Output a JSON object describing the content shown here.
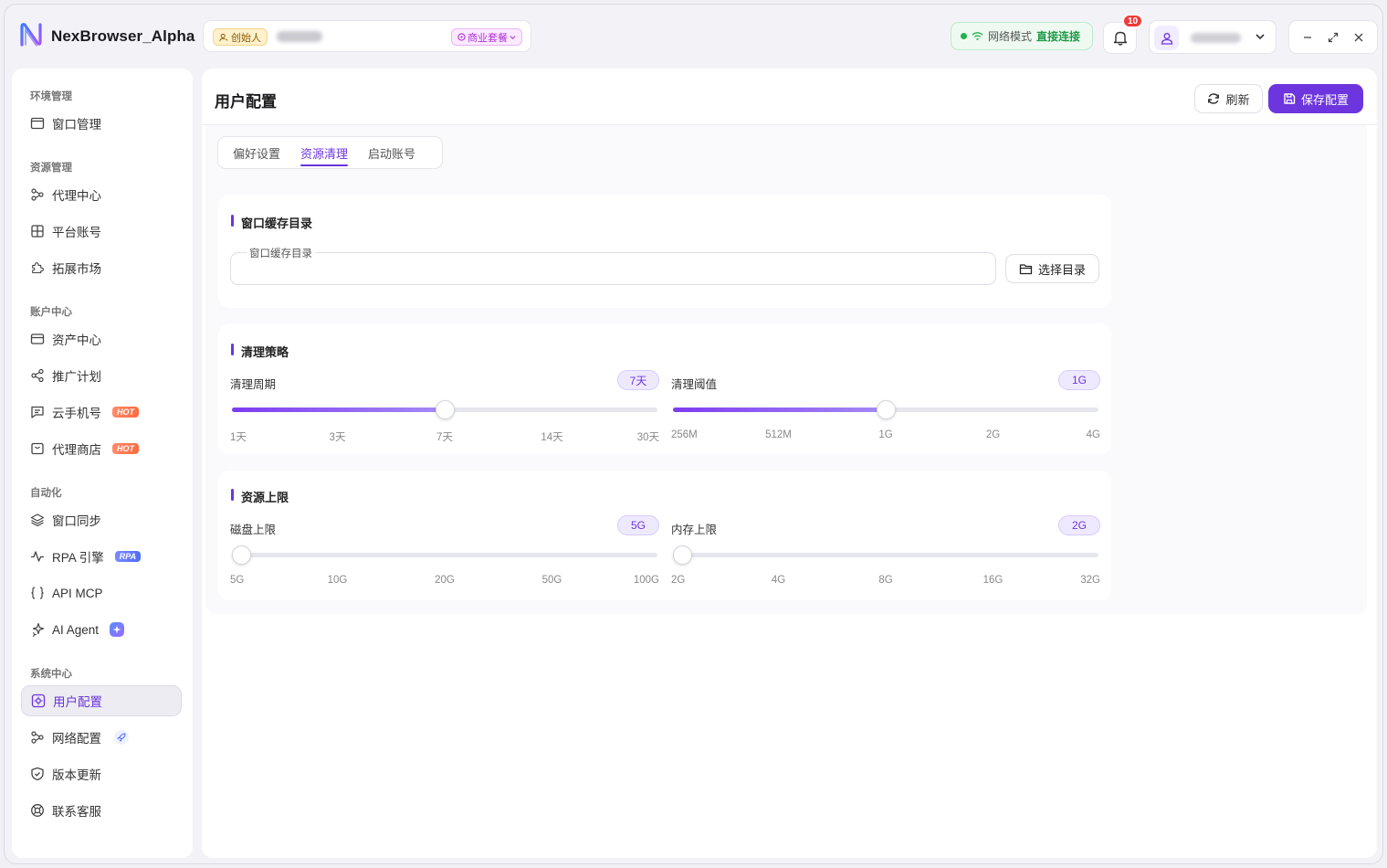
{
  "app": {
    "title": "NexBrowser_Alpha",
    "role_badge": "创始人",
    "plan_badge": "商业套餐",
    "network_label": "网络模式",
    "network_value": "直接连接",
    "notification_count": "10",
    "accent_color": "#6c35de"
  },
  "sidebar": {
    "sections": [
      {
        "title": "环境管理",
        "items": [
          {
            "label": "窗口管理",
            "icon": "window-icon"
          }
        ]
      },
      {
        "title": "资源管理",
        "items": [
          {
            "label": "代理中心",
            "icon": "proxy-icon"
          },
          {
            "label": "平台账号",
            "icon": "grid-icon"
          },
          {
            "label": "拓展市场",
            "icon": "puzzle-icon"
          }
        ]
      },
      {
        "title": "账户中心",
        "items": [
          {
            "label": "资产中心",
            "icon": "wallet-icon"
          },
          {
            "label": "推广计划",
            "icon": "share-icon"
          },
          {
            "label": "云手机号",
            "icon": "message-icon",
            "badge": "HOT"
          },
          {
            "label": "代理商店",
            "icon": "store-icon",
            "badge": "HOT"
          }
        ]
      },
      {
        "title": "自动化",
        "items": [
          {
            "label": "窗口同步",
            "icon": "layers-icon"
          },
          {
            "label": "RPA 引擎",
            "icon": "pulse-icon",
            "badge": "RPA"
          },
          {
            "label": "API MCP",
            "icon": "braces-icon"
          },
          {
            "label": "AI Agent",
            "icon": "sparkle-icon"
          }
        ]
      },
      {
        "title": "系统中心",
        "items": [
          {
            "label": "用户配置",
            "icon": "user-settings-icon",
            "active": true
          },
          {
            "label": "网络配置",
            "icon": "network-icon"
          },
          {
            "label": "版本更新",
            "icon": "shield-icon"
          },
          {
            "label": "联系客服",
            "icon": "support-icon"
          }
        ]
      }
    ]
  },
  "main": {
    "title": "用户配置",
    "refresh_label": "刷新",
    "save_label": "保存配置",
    "tabs": [
      "偏好设置",
      "资源清理",
      "启动账号"
    ],
    "active_tab": "资源清理",
    "cache_card": {
      "title": "窗口缓存目录",
      "field_label": "窗口缓存目录",
      "field_value": "",
      "button_label": "选择目录"
    },
    "cleanup_card": {
      "title": "清理策略",
      "period": {
        "label": "清理周期",
        "value": "7天",
        "ticks": [
          "1天",
          "3天",
          "7天",
          "14天",
          "30天"
        ],
        "fraction": 0.5
      },
      "threshold": {
        "label": "清理阈值",
        "value": "1G",
        "ticks": [
          "256M",
          "512M",
          "1G",
          "2G",
          "4G"
        ],
        "fraction": 0.5
      }
    },
    "limit_card": {
      "title": "资源上限",
      "disk": {
        "label": "磁盘上限",
        "value": "5G",
        "ticks": [
          "5G",
          "10G",
          "20G",
          "50G",
          "100G"
        ],
        "fraction": 0
      },
      "memory": {
        "label": "内存上限",
        "value": "2G",
        "ticks": [
          "2G",
          "4G",
          "8G",
          "16G",
          "32G"
        ],
        "fraction": 0
      }
    }
  }
}
